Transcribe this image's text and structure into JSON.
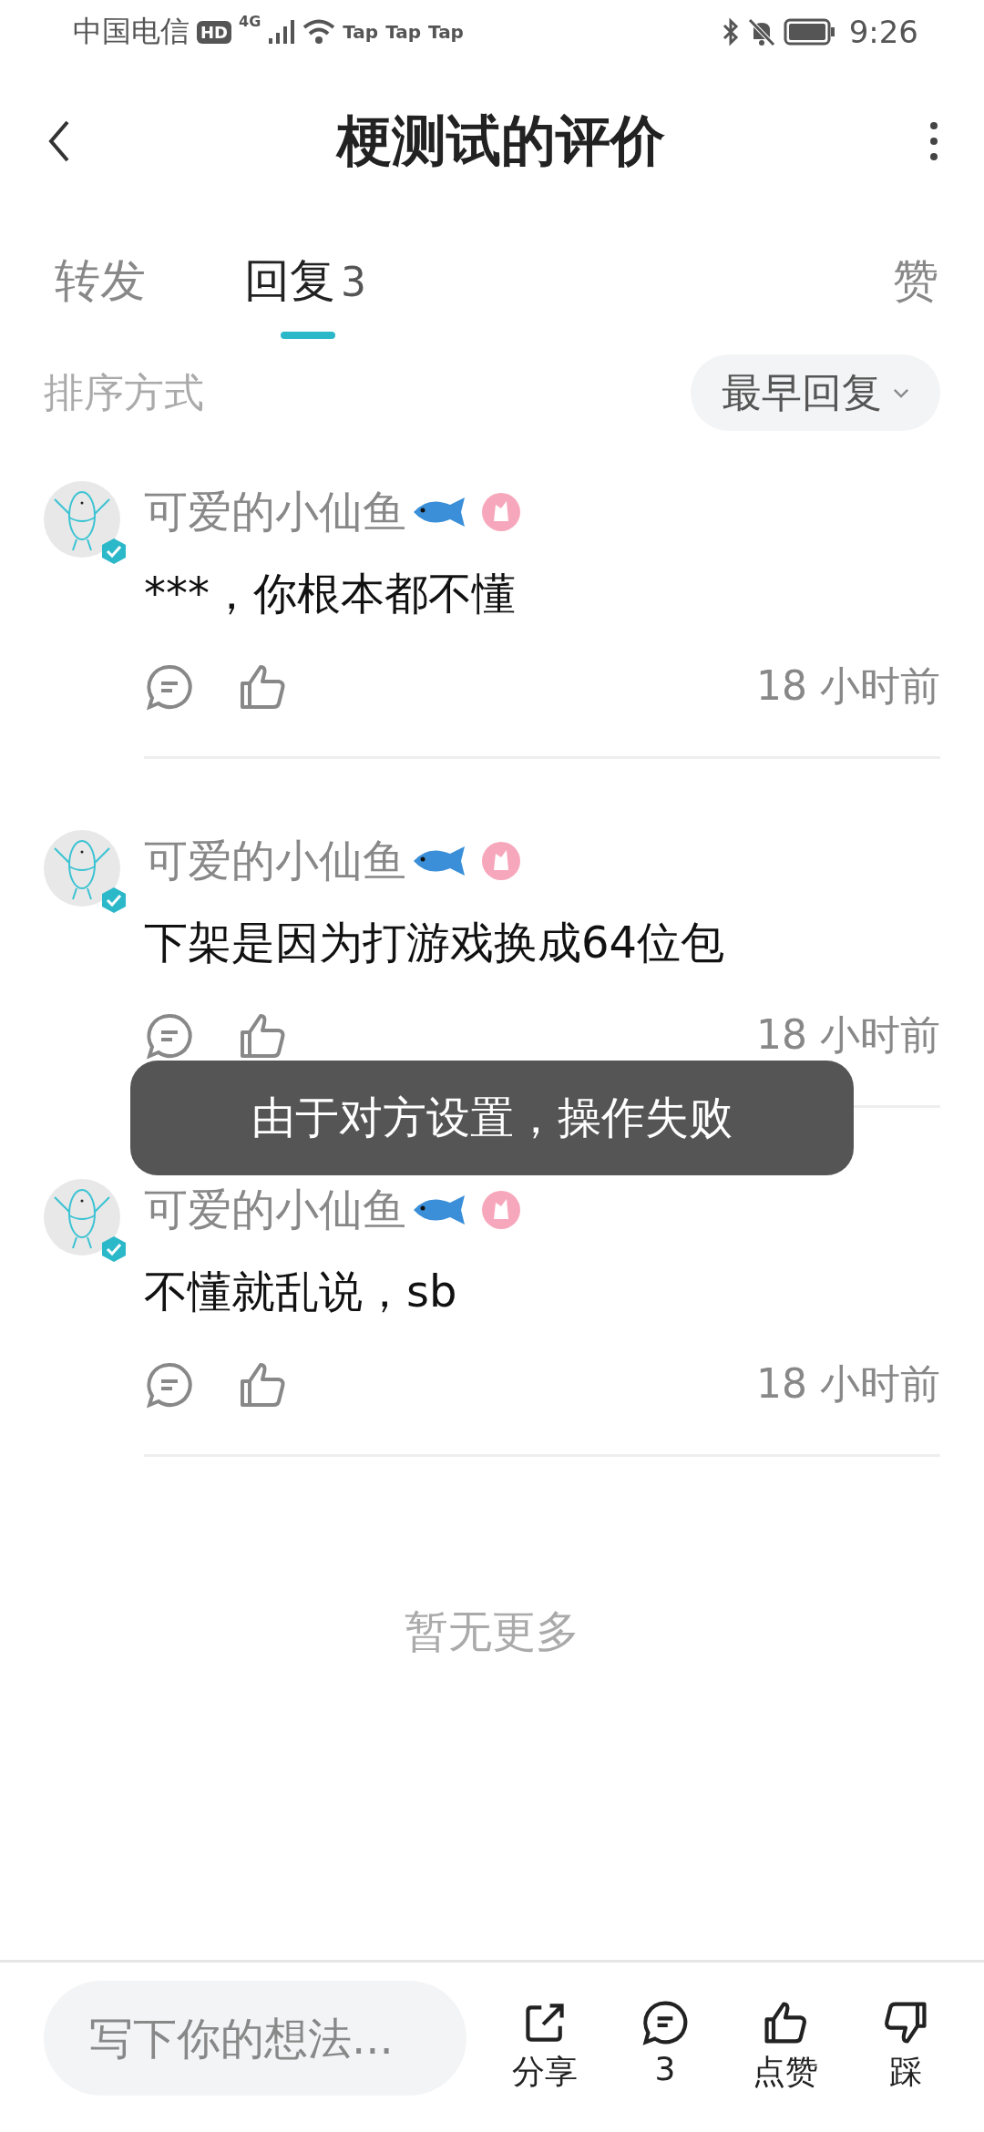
{
  "status_bar": {
    "carrier": "中国电信",
    "hd": "HD",
    "network": "4G",
    "apps": [
      "Tap",
      "Tap",
      "Tap"
    ],
    "time": "9:26"
  },
  "header": {
    "title": "梗测试的评价"
  },
  "tabs": [
    {
      "label": "转发",
      "selected": false
    },
    {
      "label": "回复",
      "count": "3",
      "selected": true
    }
  ],
  "likes_tab": {
    "label": "赞",
    "selected": false
  },
  "sort": {
    "label": "排序方式",
    "value": "最早回复"
  },
  "replies": [
    {
      "name": "可爱的小仙鱼",
      "text": "***，你根本都不懂",
      "time": "18 小时前",
      "verified": true
    },
    {
      "name": "可爱的小仙鱼",
      "text": "下架是因为打游戏换成64位包",
      "time": "18 小时前",
      "verified": true
    },
    {
      "name": "可爱的小仙鱼",
      "text": "不懂就乱说，sb",
      "time": "18 小时前",
      "verified": true
    }
  ],
  "end_note": "暂无更多",
  "toast": "由于对方设置，操作失败",
  "bottom_bar": {
    "placeholder": "写下你的想法...",
    "actions": [
      {
        "kind": "share",
        "label": "分享"
      },
      {
        "kind": "comment",
        "label": "3"
      },
      {
        "kind": "like",
        "label": "点赞"
      },
      {
        "kind": "dislike",
        "label": "踩"
      }
    ]
  }
}
